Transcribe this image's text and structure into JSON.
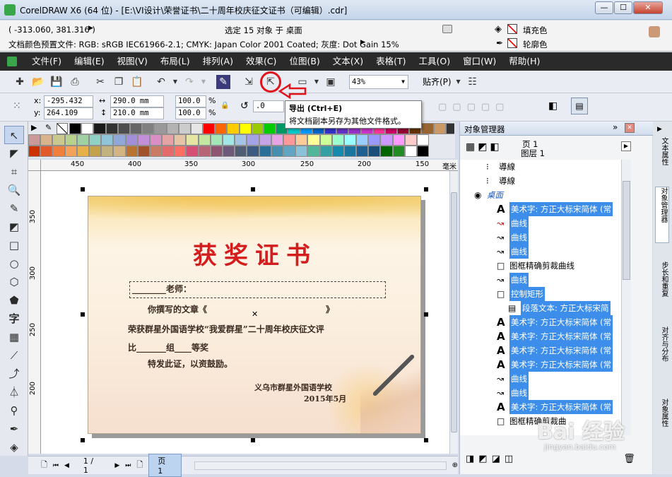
{
  "window": {
    "title": "CorelDRAW X6 (64 位) - [E:\\VI设计\\荣誉证书\\二十周年校庆征文证书（可编辑）.cdr]",
    "min": "—",
    "max": "☐",
    "close": "✕"
  },
  "status": {
    "coords": "( -313.060, 381.316 )",
    "selection": "选定 15 对象 于 桌面",
    "fill_label": "填充色",
    "outline_label": "轮廓色",
    "color_profile": "文档颜色预置文件: RGB: sRGB IEC61966-2.1; CMYK: Japan Color 2001 Coated; 灰度: Dot Gain 15%"
  },
  "menu": [
    "文件(F)",
    "编辑(E)",
    "视图(V)",
    "布局(L)",
    "排列(A)",
    "效果(C)",
    "位图(B)",
    "文本(X)",
    "表格(T)",
    "工具(O)",
    "窗口(W)",
    "帮助(H)"
  ],
  "toolbar": {
    "zoom": "43%",
    "snap": "贴齐(P)"
  },
  "props": {
    "x_label": "x:",
    "x": "-295.432 mm",
    "y_label": "y:",
    "y": "264.109 mm",
    "w": "290.0 mm",
    "h": "210.0 mm",
    "sx": "100.0",
    "sy": "100.0",
    "pct": "%",
    "rot": ".0"
  },
  "tooltip": {
    "title": "导出 (Ctrl+E)",
    "desc": "将文档副本另存为其他文件格式。"
  },
  "palette": {
    "row1": [
      "#000000",
      "#ffffff",
      "#1a1a1a",
      "#333333",
      "#4d4d4d",
      "#666666",
      "#808080",
      "#999999",
      "#b3b3b3",
      "#cccccc",
      "#e6e6e6",
      "#ff0000",
      "#ff6600",
      "#ffcc00",
      "#ffff00",
      "#99cc00",
      "#00cc00",
      "#009966",
      "#00cccc",
      "#0099ff",
      "#0066cc",
      "#3333cc",
      "#6633cc",
      "#9933cc",
      "#cc33cc",
      "#ff3399",
      "#cc0066",
      "#990033",
      "#663300",
      "#996633",
      "#cc9966",
      "#333333",
      "#000000"
    ],
    "row2": [
      "#cc9999",
      "#d9b38c",
      "#c9c98f",
      "#b8d18c",
      "#9fd1a3",
      "#8fd1c4",
      "#8fc4d9",
      "#8fa8d9",
      "#a38fd9",
      "#c48fd9",
      "#d98fc4",
      "#e6a3a3",
      "#e6c4a3",
      "#e6e6a3",
      "#c4e6a3",
      "#a3e6b8",
      "#a3e6e6",
      "#a3c4e6",
      "#a3a3e6",
      "#c4a3e6",
      "#e6a3e6",
      "#ff9999",
      "#ffcc99",
      "#ffff99",
      "#ccff99",
      "#99ffcc",
      "#99ffff",
      "#99ccff",
      "#9999ff",
      "#cc99ff",
      "#ff99ff",
      "#ffcccc",
      "#ffffff"
    ],
    "row3": [
      "#cc3300",
      "#e05a2b",
      "#f07f3c",
      "#f4a259",
      "#e8b04a",
      "#c4a24a",
      "#c2b280",
      "#d4b483",
      "#b87333",
      "#a0522d",
      "#c97b63",
      "#e36b6b",
      "#ff6f61",
      "#d65076",
      "#b56576",
      "#8e5572",
      "#6d597a",
      "#4f5d75",
      "#3d5a80",
      "#2a6f97",
      "#468faf",
      "#61a5c2",
      "#89c2d9",
      "#52b69a",
      "#34a0a4",
      "#168aad",
      "#1a759f",
      "#1e6091",
      "#184e77",
      "#006400",
      "#228b22",
      "#ffffff",
      "#000000"
    ]
  },
  "ruler": {
    "h": [
      "450",
      "400",
      "350",
      "300",
      "250",
      "200",
      "150",
      "毫米"
    ],
    "v": [
      "350",
      "300",
      "250",
      "200"
    ]
  },
  "cert": {
    "title": "获奖证书",
    "teacher": "________老师：",
    "line1": "你撰写的文章《　　　　　　　　　　　　　　》",
    "line2": "荣获群星外国语学校“我爱群星”二十周年校庆征文评",
    "line3": "比_______组____等奖",
    "line4": "特发此证，以资鼓励。",
    "org": "义乌市群星外国语学校",
    "date": "2015年5月"
  },
  "pagebar": {
    "pages": "1 / 1",
    "page_tab": "页 1"
  },
  "objmgr": {
    "title": "对象管理器",
    "page": "页 1",
    "layer": "图层 1",
    "rows": [
      {
        "label": "導線",
        "indent": 55,
        "sel": false,
        "icon": "dots"
      },
      {
        "label": "導線",
        "indent": 55,
        "sel": false,
        "icon": "dots"
      },
      {
        "label": "桌面",
        "indent": 38,
        "sel": false,
        "icon": "layer",
        "blue": true
      },
      {
        "label": "美术字: 方正大标宋简体 (常",
        "indent": 70,
        "sel": true,
        "icon": "A"
      },
      {
        "label": "曲线",
        "indent": 70,
        "sel": true,
        "icon": "curve-red"
      },
      {
        "label": "曲线",
        "indent": 70,
        "sel": true,
        "icon": "curve"
      },
      {
        "label": "曲线",
        "indent": 70,
        "sel": true,
        "icon": "curve"
      },
      {
        "label": "图框精确剪裁曲线",
        "indent": 70,
        "sel": false,
        "icon": "box"
      },
      {
        "label": "曲线",
        "indent": 70,
        "sel": true,
        "icon": "curve"
      },
      {
        "label": "控制矩形",
        "indent": 70,
        "sel": true,
        "icon": "box"
      },
      {
        "label": "段落文本: 方正大标宋简",
        "indent": 86,
        "sel": true,
        "icon": "para"
      },
      {
        "label": "美术字: 方正大标宋简体 (常",
        "indent": 70,
        "sel": true,
        "icon": "A"
      },
      {
        "label": "美术字: 方正大标宋简体 (常",
        "indent": 70,
        "sel": true,
        "icon": "A"
      },
      {
        "label": "美术字: 方正大标宋简体 (常",
        "indent": 70,
        "sel": true,
        "icon": "A"
      },
      {
        "label": "美术字: 方正大标宋简体 (常",
        "indent": 70,
        "sel": true,
        "icon": "A"
      },
      {
        "label": "曲线",
        "indent": 70,
        "sel": true,
        "icon": "curve"
      },
      {
        "label": "曲线",
        "indent": 70,
        "sel": true,
        "icon": "curve"
      },
      {
        "label": "美术字: 方正大标宋简体 (常",
        "indent": 70,
        "sel": true,
        "icon": "A"
      },
      {
        "label": "图框精确剪裁曲",
        "indent": 70,
        "sel": false,
        "icon": "box"
      }
    ]
  },
  "dockertabs": [
    "文本属性",
    "对象管理器",
    "步长和重复",
    "对齐与分布",
    "对象属性"
  ],
  "watermark": "Bai 经验",
  "watermark_url": "jingyan.baidu.com"
}
